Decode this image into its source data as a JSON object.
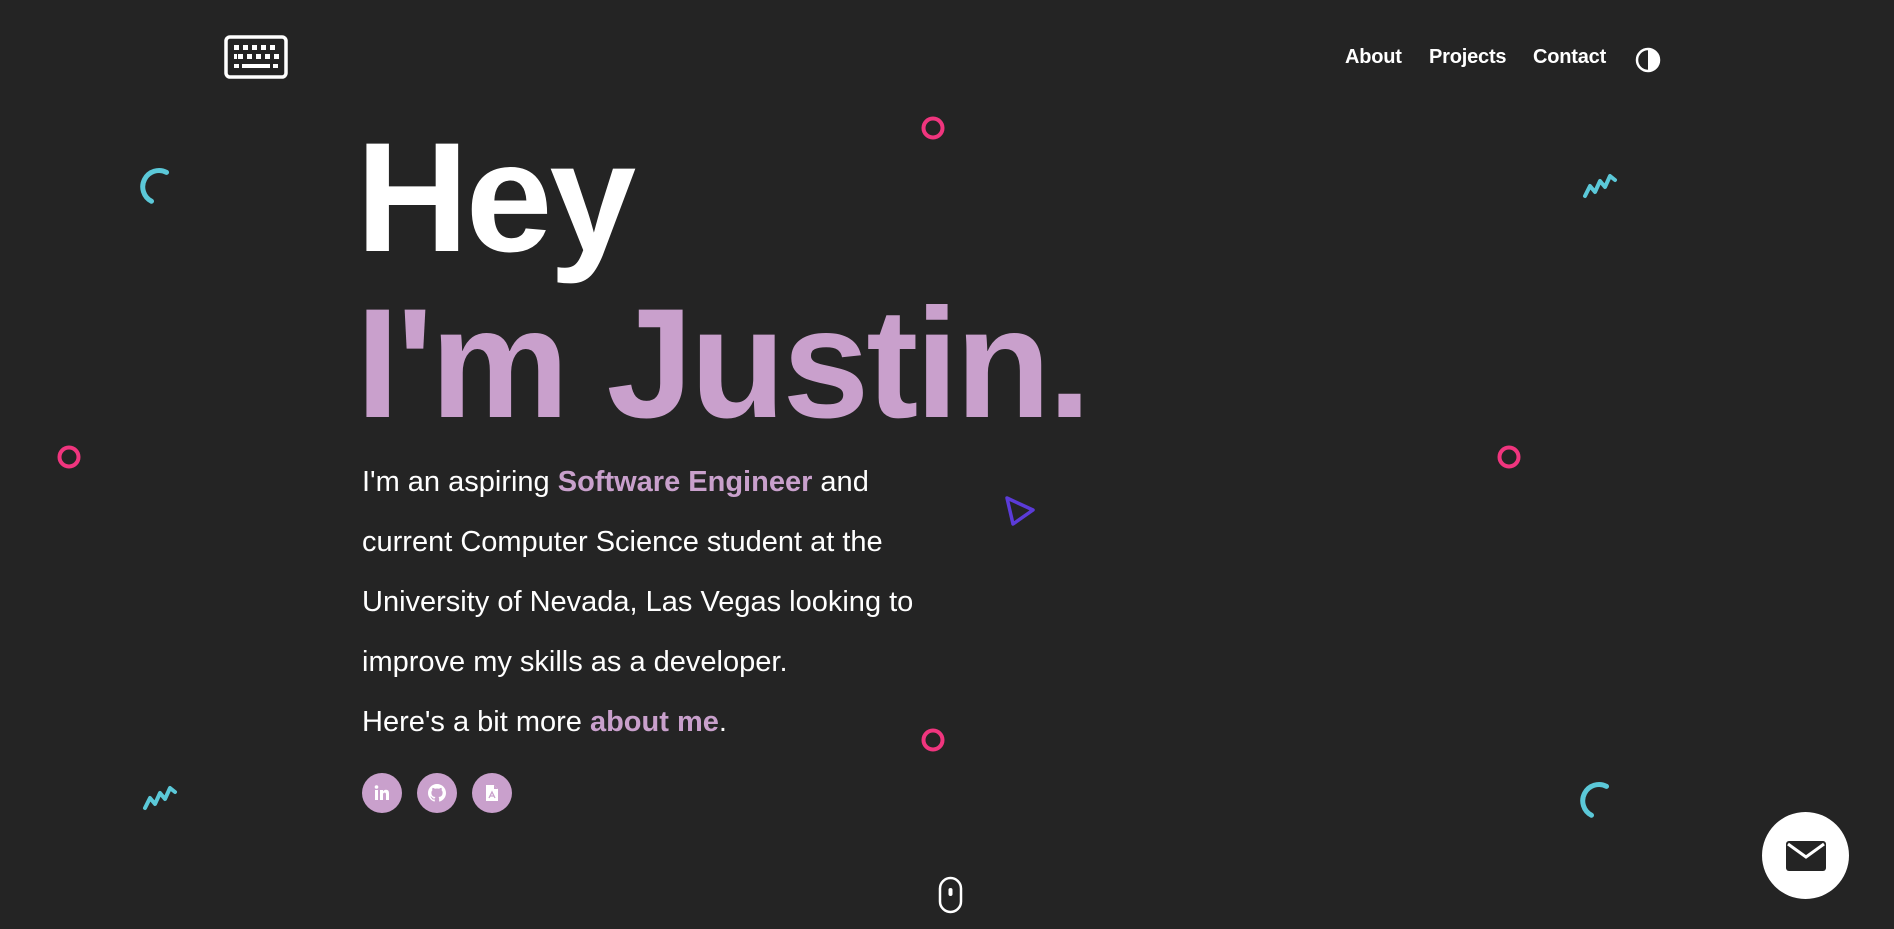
{
  "header": {
    "logo_icon": "keyboard-icon",
    "nav": {
      "about": "About",
      "projects": "Projects",
      "contact": "Contact"
    },
    "theme_toggle_icon": "half-circle-contrast-icon"
  },
  "hero": {
    "greeting": "Hey",
    "name": "I'm Justin.",
    "bio": {
      "part1": "I'm an aspiring ",
      "highlight": "Software Engineer",
      "part2": " and current Computer Science student at the University of Nevada, Las Vegas looking to improve my skills as a developer.",
      "part3": "Here's a bit more ",
      "about_link": "about me",
      "part4": "."
    },
    "socials": [
      {
        "icon": "linkedin-icon"
      },
      {
        "icon": "github-icon"
      },
      {
        "icon": "resume-pdf-icon"
      }
    ]
  },
  "scroll_indicator_icon": "mouse-scroll-icon",
  "mail_button_icon": "envelope-icon",
  "colors": {
    "background": "#242424",
    "accent": "#c9a0cc",
    "text": "#ffffff",
    "pink_shape": "#f0357e",
    "cyan_shape": "#5bc8d8",
    "purple_shape": "#5b3bd8"
  }
}
